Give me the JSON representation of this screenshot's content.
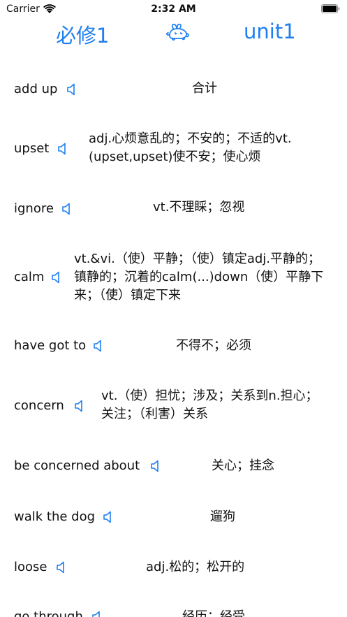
{
  "status_bar": {
    "carrier": "Carrier",
    "time": "2:32 AM"
  },
  "nav": {
    "left_title": "必修1",
    "right_title": "unit1",
    "center_icon": "rabbit-icon"
  },
  "colors": {
    "accent": "#1f7ff0",
    "text": "#111111"
  },
  "entries": [
    {
      "word": "add up",
      "meaning": "合计"
    },
    {
      "word": "upset",
      "meaning": "adj.心烦意乱的；不安的；不适的vt.(upset,upset)使不安；使心烦"
    },
    {
      "word": "ignore",
      "meaning": "vt.不理睬；忽视"
    },
    {
      "word": "calm",
      "meaning": "vt.&vi.（使）平静；（使）镇定adj.平静的；镇静的；沉着的calm(...)down（使）平静下来；（使）镇定下来"
    },
    {
      "word": "have got to",
      "meaning": "不得不；必须"
    },
    {
      "word": "concern",
      "meaning": "vt.（使）担忧；涉及；关系到n.担心；关注；（利害）关系"
    },
    {
      "word": "be concerned about",
      "meaning": "关心；挂念"
    },
    {
      "word": "walk the dog",
      "meaning": "遛狗"
    },
    {
      "word": "loose",
      "meaning": "adj.松的；松开的"
    },
    {
      "word": "go through",
      "meaning": "经历；经受"
    }
  ]
}
